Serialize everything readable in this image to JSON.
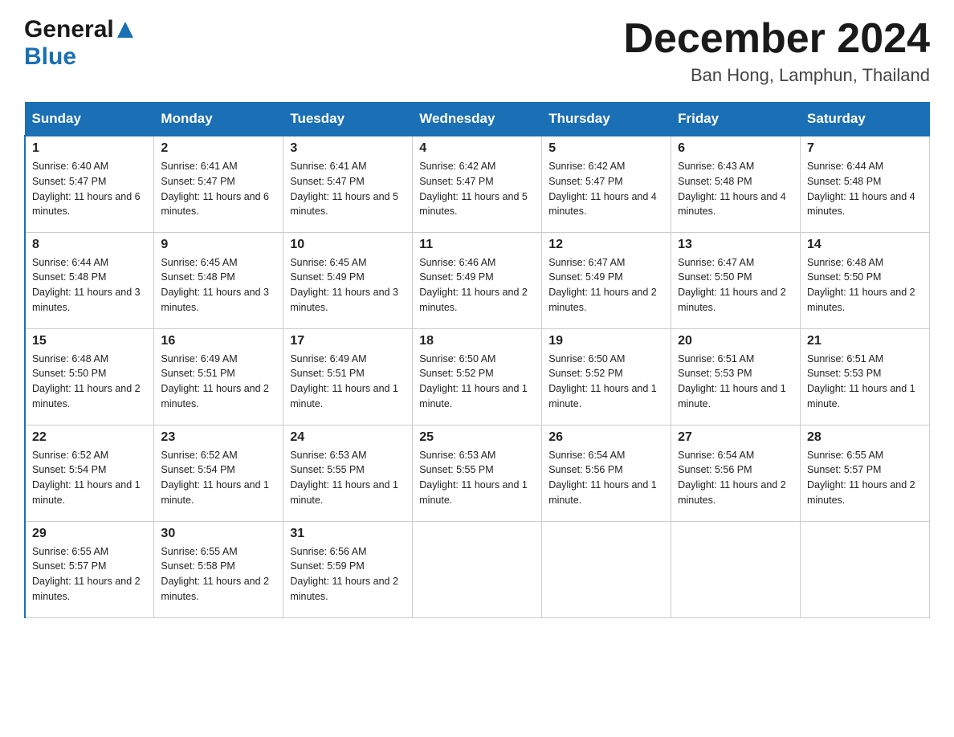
{
  "header": {
    "logo_general": "General",
    "logo_blue": "Blue",
    "month_title": "December 2024",
    "location": "Ban Hong, Lamphun, Thailand"
  },
  "weekdays": [
    "Sunday",
    "Monday",
    "Tuesday",
    "Wednesday",
    "Thursday",
    "Friday",
    "Saturday"
  ],
  "weeks": [
    [
      {
        "day": "1",
        "sunrise": "6:40 AM",
        "sunset": "5:47 PM",
        "daylight": "11 hours and 6 minutes."
      },
      {
        "day": "2",
        "sunrise": "6:41 AM",
        "sunset": "5:47 PM",
        "daylight": "11 hours and 6 minutes."
      },
      {
        "day": "3",
        "sunrise": "6:41 AM",
        "sunset": "5:47 PM",
        "daylight": "11 hours and 5 minutes."
      },
      {
        "day": "4",
        "sunrise": "6:42 AM",
        "sunset": "5:47 PM",
        "daylight": "11 hours and 5 minutes."
      },
      {
        "day": "5",
        "sunrise": "6:42 AM",
        "sunset": "5:47 PM",
        "daylight": "11 hours and 4 minutes."
      },
      {
        "day": "6",
        "sunrise": "6:43 AM",
        "sunset": "5:48 PM",
        "daylight": "11 hours and 4 minutes."
      },
      {
        "day": "7",
        "sunrise": "6:44 AM",
        "sunset": "5:48 PM",
        "daylight": "11 hours and 4 minutes."
      }
    ],
    [
      {
        "day": "8",
        "sunrise": "6:44 AM",
        "sunset": "5:48 PM",
        "daylight": "11 hours and 3 minutes."
      },
      {
        "day": "9",
        "sunrise": "6:45 AM",
        "sunset": "5:48 PM",
        "daylight": "11 hours and 3 minutes."
      },
      {
        "day": "10",
        "sunrise": "6:45 AM",
        "sunset": "5:49 PM",
        "daylight": "11 hours and 3 minutes."
      },
      {
        "day": "11",
        "sunrise": "6:46 AM",
        "sunset": "5:49 PM",
        "daylight": "11 hours and 2 minutes."
      },
      {
        "day": "12",
        "sunrise": "6:47 AM",
        "sunset": "5:49 PM",
        "daylight": "11 hours and 2 minutes."
      },
      {
        "day": "13",
        "sunrise": "6:47 AM",
        "sunset": "5:50 PM",
        "daylight": "11 hours and 2 minutes."
      },
      {
        "day": "14",
        "sunrise": "6:48 AM",
        "sunset": "5:50 PM",
        "daylight": "11 hours and 2 minutes."
      }
    ],
    [
      {
        "day": "15",
        "sunrise": "6:48 AM",
        "sunset": "5:50 PM",
        "daylight": "11 hours and 2 minutes."
      },
      {
        "day": "16",
        "sunrise": "6:49 AM",
        "sunset": "5:51 PM",
        "daylight": "11 hours and 2 minutes."
      },
      {
        "day": "17",
        "sunrise": "6:49 AM",
        "sunset": "5:51 PM",
        "daylight": "11 hours and 1 minute."
      },
      {
        "day": "18",
        "sunrise": "6:50 AM",
        "sunset": "5:52 PM",
        "daylight": "11 hours and 1 minute."
      },
      {
        "day": "19",
        "sunrise": "6:50 AM",
        "sunset": "5:52 PM",
        "daylight": "11 hours and 1 minute."
      },
      {
        "day": "20",
        "sunrise": "6:51 AM",
        "sunset": "5:53 PM",
        "daylight": "11 hours and 1 minute."
      },
      {
        "day": "21",
        "sunrise": "6:51 AM",
        "sunset": "5:53 PM",
        "daylight": "11 hours and 1 minute."
      }
    ],
    [
      {
        "day": "22",
        "sunrise": "6:52 AM",
        "sunset": "5:54 PM",
        "daylight": "11 hours and 1 minute."
      },
      {
        "day": "23",
        "sunrise": "6:52 AM",
        "sunset": "5:54 PM",
        "daylight": "11 hours and 1 minute."
      },
      {
        "day": "24",
        "sunrise": "6:53 AM",
        "sunset": "5:55 PM",
        "daylight": "11 hours and 1 minute."
      },
      {
        "day": "25",
        "sunrise": "6:53 AM",
        "sunset": "5:55 PM",
        "daylight": "11 hours and 1 minute."
      },
      {
        "day": "26",
        "sunrise": "6:54 AM",
        "sunset": "5:56 PM",
        "daylight": "11 hours and 1 minute."
      },
      {
        "day": "27",
        "sunrise": "6:54 AM",
        "sunset": "5:56 PM",
        "daylight": "11 hours and 2 minutes."
      },
      {
        "day": "28",
        "sunrise": "6:55 AM",
        "sunset": "5:57 PM",
        "daylight": "11 hours and 2 minutes."
      }
    ],
    [
      {
        "day": "29",
        "sunrise": "6:55 AM",
        "sunset": "5:57 PM",
        "daylight": "11 hours and 2 minutes."
      },
      {
        "day": "30",
        "sunrise": "6:55 AM",
        "sunset": "5:58 PM",
        "daylight": "11 hours and 2 minutes."
      },
      {
        "day": "31",
        "sunrise": "6:56 AM",
        "sunset": "5:59 PM",
        "daylight": "11 hours and 2 minutes."
      },
      null,
      null,
      null,
      null
    ]
  ]
}
